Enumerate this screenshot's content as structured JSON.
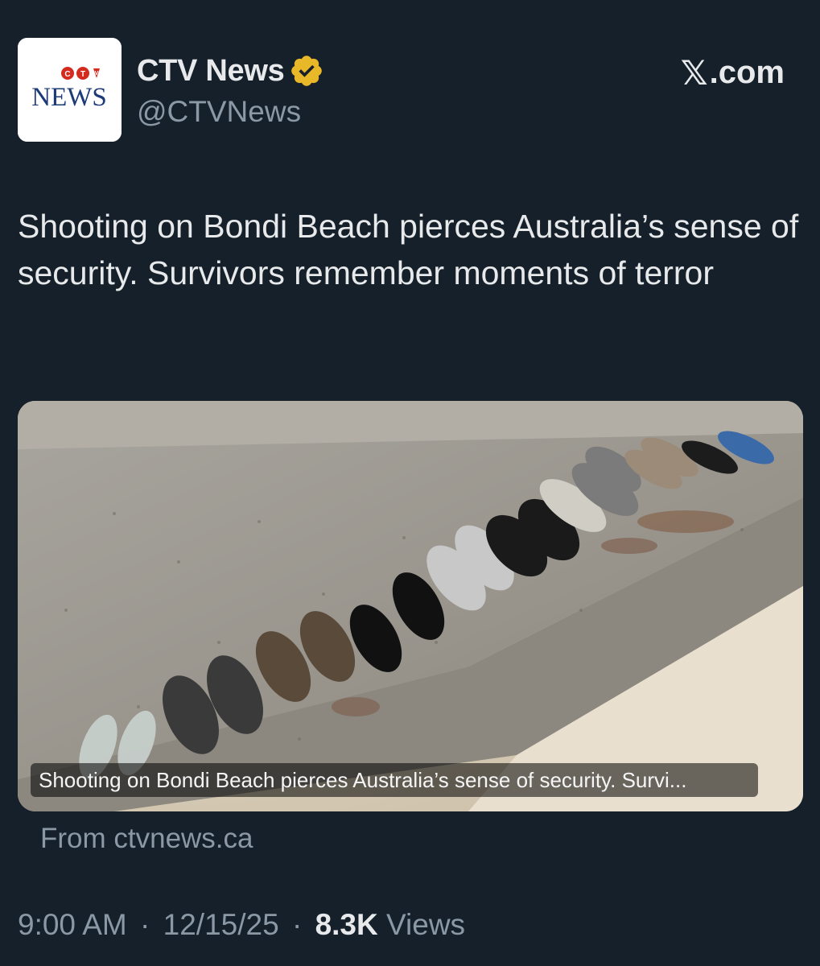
{
  "account": {
    "display_name": "CTV News",
    "handle": "@CTVNews",
    "verified_icon": "gold-verified-badge",
    "logo_top": "CTV",
    "logo_bottom": "NEWS"
  },
  "brand": {
    "x_glyph": "𝕏",
    "label": ".com"
  },
  "tweet": {
    "text": "Shooting on Bondi Beach pierces Australia’s sense of security. Survivors remember moments of terror"
  },
  "card": {
    "caption": "Shooting on Bondi Beach pierces Australia’s sense of security. Survi...",
    "source": "From ctvnews.ca"
  },
  "meta": {
    "time": "9:00 AM",
    "separator": "·",
    "date": "12/15/25",
    "views_count": "8.3K",
    "views_label": "Views"
  },
  "colors": {
    "background": "#15202b",
    "text_primary": "#e7e9ea",
    "text_secondary": "#8b98a5",
    "verified_gold": "#e8b829",
    "ctv_red": "#d52b1e",
    "ctv_blue": "#1d3a78"
  }
}
